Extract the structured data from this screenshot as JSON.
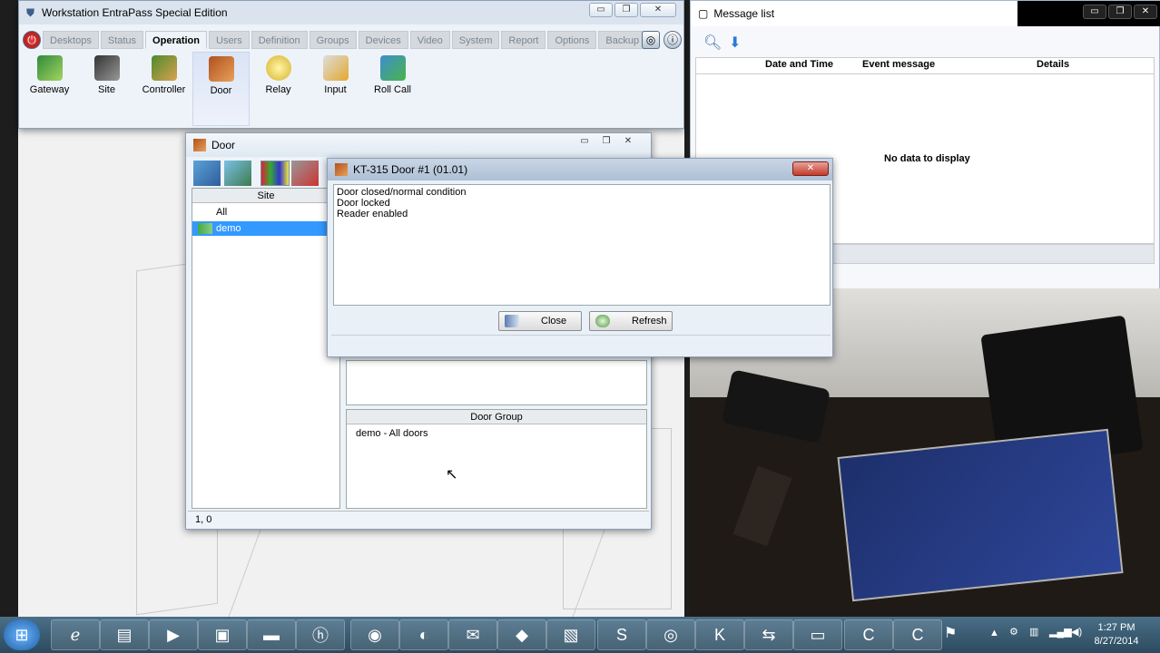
{
  "main_window": {
    "title": "Workstation EntraPass Special Edition",
    "tabs": [
      "Desktops",
      "Status",
      "Operation",
      "Users",
      "Definition",
      "Groups",
      "Devices",
      "Video",
      "System",
      "Report",
      "Options",
      "Backup"
    ],
    "active_tab": "Operation",
    "tools": [
      {
        "label": "Gateway",
        "icon": "gateway-icon"
      },
      {
        "label": "Site",
        "icon": "site-icon"
      },
      {
        "label": "Controller",
        "icon": "controller-icon"
      },
      {
        "label": "Door",
        "icon": "door-icon"
      },
      {
        "label": "Relay",
        "icon": "relay-icon"
      },
      {
        "label": "Input",
        "icon": "input-icon"
      },
      {
        "label": "Roll Call",
        "icon": "roll-call-icon"
      }
    ],
    "min_glyph": "▭",
    "max_glyph": "❐",
    "close_glyph": "✕"
  },
  "message_list": {
    "title": "Message list",
    "columns": [
      "Date and Time",
      "Event message",
      "Details"
    ],
    "empty_text": "No data to display"
  },
  "door_window": {
    "title": "Door",
    "site_header": "Site",
    "sites": [
      "All",
      "demo"
    ],
    "selected_site": "demo",
    "door_group_header": "Door Group",
    "door_groups": [
      "demo - All doors"
    ],
    "status_text": "1, 0"
  },
  "dialog": {
    "title": "KT-315 Door #1 (01.01)",
    "lines": [
      "Door closed/normal condition",
      "Door locked",
      "Reader enabled"
    ],
    "close_label": "Close",
    "refresh_label": "Refresh"
  },
  "taskbar": {
    "time": "1:27 PM",
    "date": "8/27/2014"
  },
  "colors": {
    "accent": "#3399ff",
    "selection": "#3399ff"
  }
}
